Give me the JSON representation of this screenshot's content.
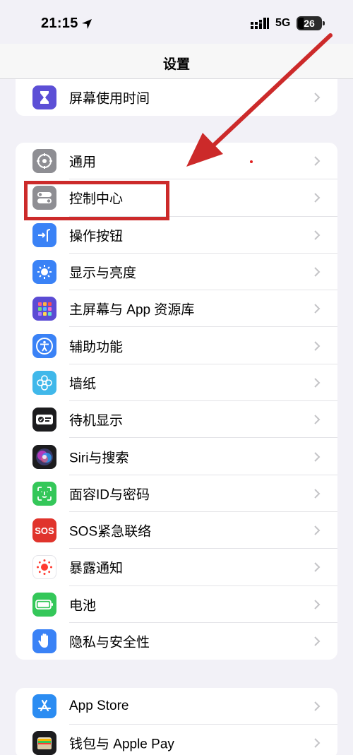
{
  "status_bar": {
    "time": "21:15",
    "network": "5G",
    "battery": "26"
  },
  "nav": {
    "title": "设置"
  },
  "group1": [
    {
      "label": "屏幕使用时间",
      "icon": "hourglass-icon",
      "color": "#5c4fd6"
    }
  ],
  "group2": [
    {
      "label": "通用",
      "icon": "gear-icon",
      "color": "#8e8e93"
    },
    {
      "label": "控制中心",
      "icon": "toggles-icon",
      "color": "#8e8e93"
    },
    {
      "label": "操作按钮",
      "icon": "action-button-icon",
      "color": "#3a82f6"
    },
    {
      "label": "显示与亮度",
      "icon": "sun-icon",
      "color": "#3a82f6"
    },
    {
      "label": "主屏幕与 App 资源库",
      "icon": "home-grid-icon",
      "color": "#5b4bd4"
    },
    {
      "label": "辅助功能",
      "icon": "accessibility-icon",
      "color": "#3a82f6"
    },
    {
      "label": "墙纸",
      "icon": "flower-icon",
      "color": "#40b8ea"
    },
    {
      "label": "待机显示",
      "icon": "standby-icon",
      "color": "#1c1c1e"
    },
    {
      "label": "Siri与搜索",
      "icon": "siri-icon",
      "color": "#1c1c1e"
    },
    {
      "label": "面容ID与密码",
      "icon": "face-id-icon",
      "color": "#34c759"
    },
    {
      "label": "SOS紧急联络",
      "icon": "sos-icon",
      "color": "#e0342c"
    },
    {
      "label": "暴露通知",
      "icon": "exposure-icon",
      "color": "#ffffff"
    },
    {
      "label": "电池",
      "icon": "battery-icon",
      "color": "#34c759"
    },
    {
      "label": "隐私与安全性",
      "icon": "hand-icon",
      "color": "#3a82f6"
    }
  ],
  "group3": [
    {
      "label": "App Store",
      "icon": "app-store-icon",
      "color": "#2b8cf2"
    },
    {
      "label": "钱包与 Apple Pay",
      "icon": "wallet-icon",
      "color": "#1c1c1e"
    }
  ],
  "sos_text": "SOS",
  "colors": {
    "annotation_red": "#cc2a2a",
    "background": "#f2f1f7"
  }
}
